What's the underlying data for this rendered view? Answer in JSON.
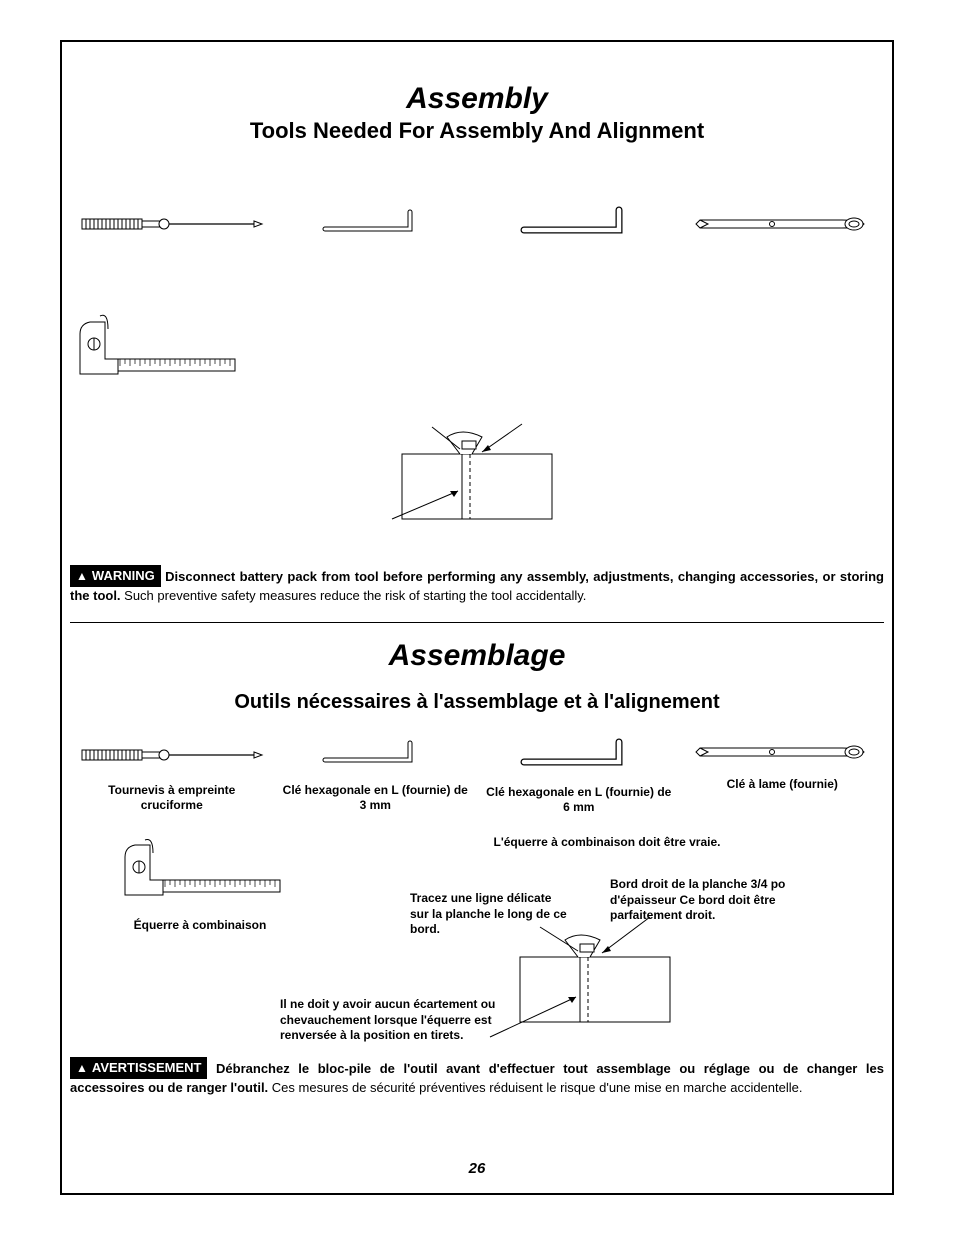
{
  "page_number": "26",
  "english": {
    "title": "Assembly",
    "subtitle": "Tools Needed For Assembly And Alignment",
    "warning_label": "WARNING",
    "warning_bold": "Disconnect battery pack from tool before performing any assembly, adjustments, changing accessories, or storing the tool.",
    "warning_rest": " Such preventive safety measures reduce the risk of starting the tool accidentally."
  },
  "french": {
    "title": "Assemblage",
    "subtitle": "Outils nécessaires à l'assemblage et à l'alignement",
    "tools": {
      "screwdriver": "Tournevis à empreinte cruciforme",
      "hex3": "Clé hexagonale en L (fournie) de 3 mm",
      "hex6": "Clé hexagonale en L (fournie) de 6 mm",
      "blade": "Clé à lame (fournie)",
      "combo": "Équerre à combinaison"
    },
    "note_top": "L'équerre à combinaison doit être vraie.",
    "anno_left": "Tracez une ligne délicate sur la planche le long de ce bord.",
    "anno_right": "Bord droit de la planche 3/4 po d'épaisseur Ce bord doit être parfaitement droit.",
    "anno_bottom": "Il ne doit y avoir aucun écartement ou chevauchement lorsque l'équerre est renversée à la position en tirets.",
    "warning_label": "AVERTISSEMENT",
    "warning_bold": "Débranchez le bloc-pile de l'outil avant d'effectuer tout assemblage ou réglage ou de changer les accessoires ou de ranger l'outil.",
    "warning_rest": " Ces mesures de sécurité préventives réduisent le risque d'une mise en marche accidentelle."
  }
}
